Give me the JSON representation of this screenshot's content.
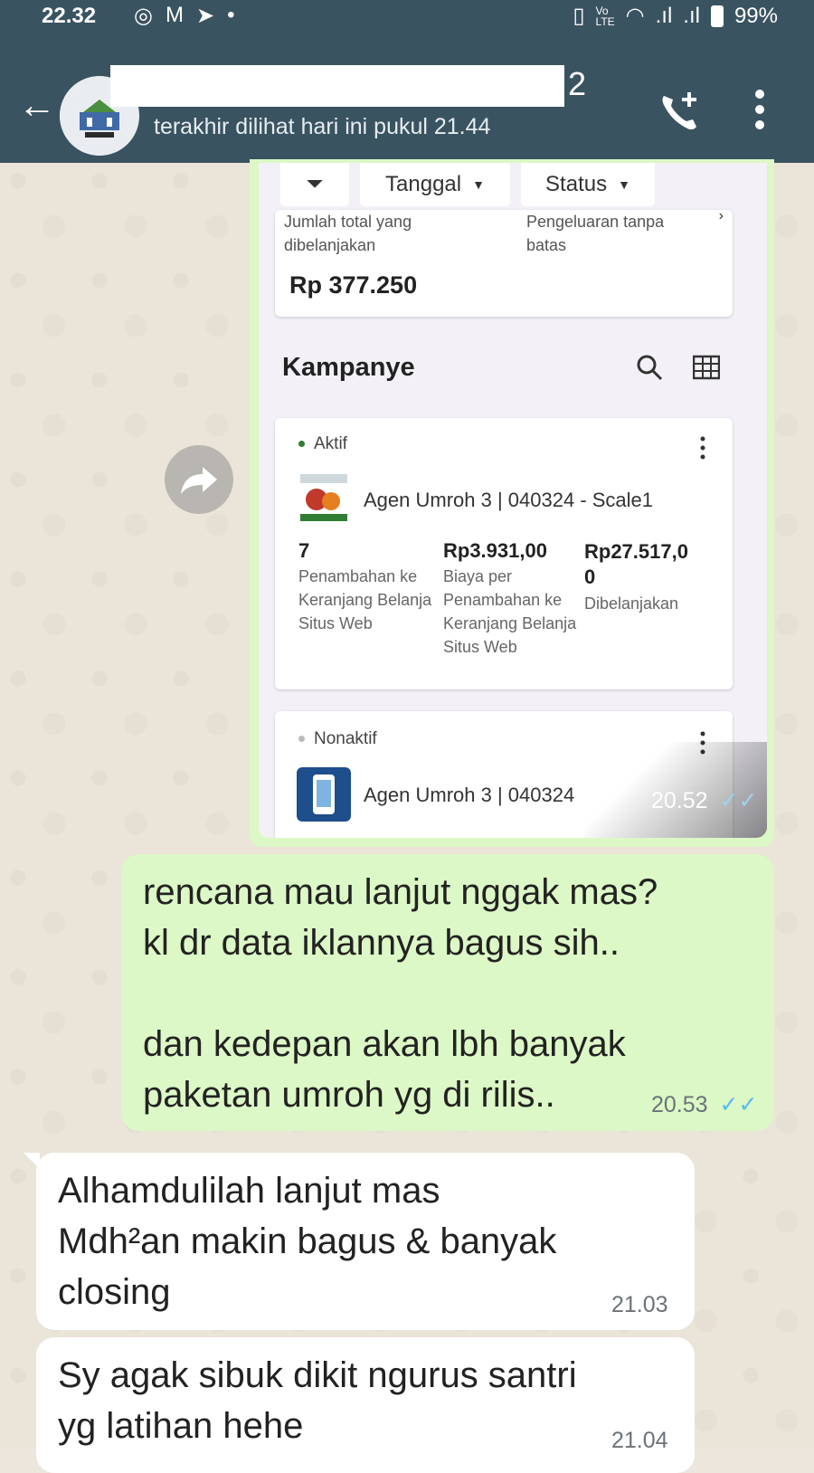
{
  "status_bar": {
    "time": "22.32",
    "left_icons": [
      "instagram-icon",
      "gmail-icon",
      "telegram-icon",
      "dot-icon"
    ],
    "right_icons": [
      "vibrate-icon",
      "volte-icon",
      "wifi-icon",
      "signal-icon",
      "signal-icon"
    ],
    "battery": "99%"
  },
  "chat_header": {
    "contact_name_visible_suffix": "2",
    "last_seen": "terakhir dilihat hari ini pukul 21.44",
    "icons": [
      "back-arrow-icon",
      "avatar",
      "add-call-icon",
      "more-vert-icon"
    ]
  },
  "shared_image": {
    "filters": {
      "filter_icon": "filter-icon",
      "date_label": "Tanggal",
      "status_label": "Status"
    },
    "summary": {
      "total_label": "Jumlah total yang dibelanjakan",
      "total_value": "Rp 377.250",
      "limit_label": "Pengeluaran tanpa batas"
    },
    "section_title": "Kampanye",
    "campaigns": [
      {
        "status": "Aktif",
        "name": "Agen Umroh 3 | 040324 - Scale1",
        "metrics": [
          {
            "value": "7",
            "label": "Penambahan ke Keranjang Belanja Situs Web"
          },
          {
            "value": "Rp3.931,00",
            "label": "Biaya per Penambahan ke Keranjang Belanja Situs Web"
          },
          {
            "value": "Rp27.517,0\n0",
            "label": "Dibelanjakan"
          }
        ]
      },
      {
        "status": "Nonaktif",
        "name": "Agen Umroh 3 | 040324"
      }
    ],
    "time": "20.52",
    "colors": {
      "active_dot": "#2e7d32",
      "inactive_dot": "#bbbbbb",
      "read_ticks": "#53bdeb"
    }
  },
  "messages": [
    {
      "direction": "out",
      "text": "rencana mau lanjut nggak mas?\nkl dr data iklannya bagus sih..\n\ndan kedepan akan lbh banyak\npaketan umroh yg di rilis..",
      "time": "20.53"
    },
    {
      "direction": "in",
      "text": "Alhamdulilah lanjut mas\nMdh²an makin bagus & banyak\nclosing",
      "time": "21.03"
    },
    {
      "direction": "in",
      "text": "Sy agak sibuk dikit ngurus santri\nyg latihan hehe",
      "time": "21.04"
    }
  ],
  "colors": {
    "header": "#3a5361",
    "outgoing_bubble": "#dcf8c6",
    "incoming_bubble": "#ffffff"
  }
}
